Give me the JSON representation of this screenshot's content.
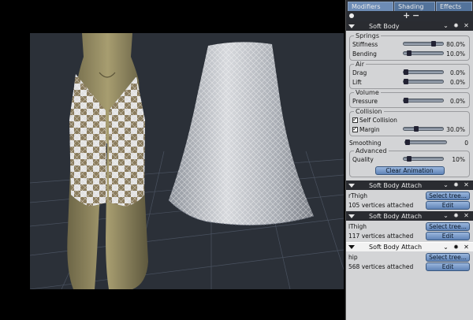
{
  "tabs": [
    {
      "label": "Modifiers",
      "active": true
    },
    {
      "label": "Shading",
      "active": false
    },
    {
      "label": "Effects",
      "active": false
    }
  ],
  "toolbar": {
    "add": "+",
    "remove": "−"
  },
  "soft_body": {
    "title": "Soft Body",
    "springs": {
      "title": "Springs",
      "stiffness": {
        "label": "Stiffness",
        "value": "80.0%",
        "fraction": 0.8
      },
      "bending": {
        "label": "Bending",
        "value": "10.0%",
        "fraction": 0.1
      }
    },
    "air": {
      "title": "Air",
      "drag": {
        "label": "Drag",
        "value": "0.0%",
        "fraction": 0.0
      },
      "lift": {
        "label": "Lift",
        "value": "0.0%",
        "fraction": 0.0
      }
    },
    "volume": {
      "title": "Volume",
      "pressure": {
        "label": "Pressure",
        "value": "0.0%",
        "fraction": 0.0
      }
    },
    "collision": {
      "title": "Collision",
      "self_collision": {
        "label": "Self Collision",
        "checked": true
      },
      "margin": {
        "label": "Margin",
        "value": "30.0%",
        "fraction": 0.3,
        "checked": true
      }
    },
    "smoothing": {
      "label": "Smoothing",
      "value": "0",
      "fraction": 0.0
    },
    "advanced": {
      "title": "Advanced",
      "quality": {
        "label": "Quality",
        "value": "10%",
        "fraction": 0.1
      }
    },
    "clear_button": "Clear Animation"
  },
  "attachments": [
    {
      "title": "Soft Body Attach",
      "name": "rThigh",
      "info": "105 vertices attached",
      "select_label": "Select tree...",
      "edit_label": "Edit",
      "highlighted": false
    },
    {
      "title": "Soft Body Attach",
      "name": "lThigh",
      "info": "117 vertices attached",
      "select_label": "Select tree...",
      "edit_label": "Edit",
      "highlighted": false
    },
    {
      "title": "Soft Body Attach",
      "name": "hip",
      "info": "568 vertices attached",
      "select_label": "Select tree...",
      "edit_label": "Edit",
      "highlighted": true
    }
  ],
  "colors": {
    "scene_bg": "#2b3038",
    "panel_bg": "#d3d4d6",
    "header_dark": "#2a2c31",
    "button_blue": "#7a9cca"
  },
  "icons": {
    "collapse": "chevron-down-icon",
    "gear": "gear-icon",
    "close": "close-icon"
  }
}
